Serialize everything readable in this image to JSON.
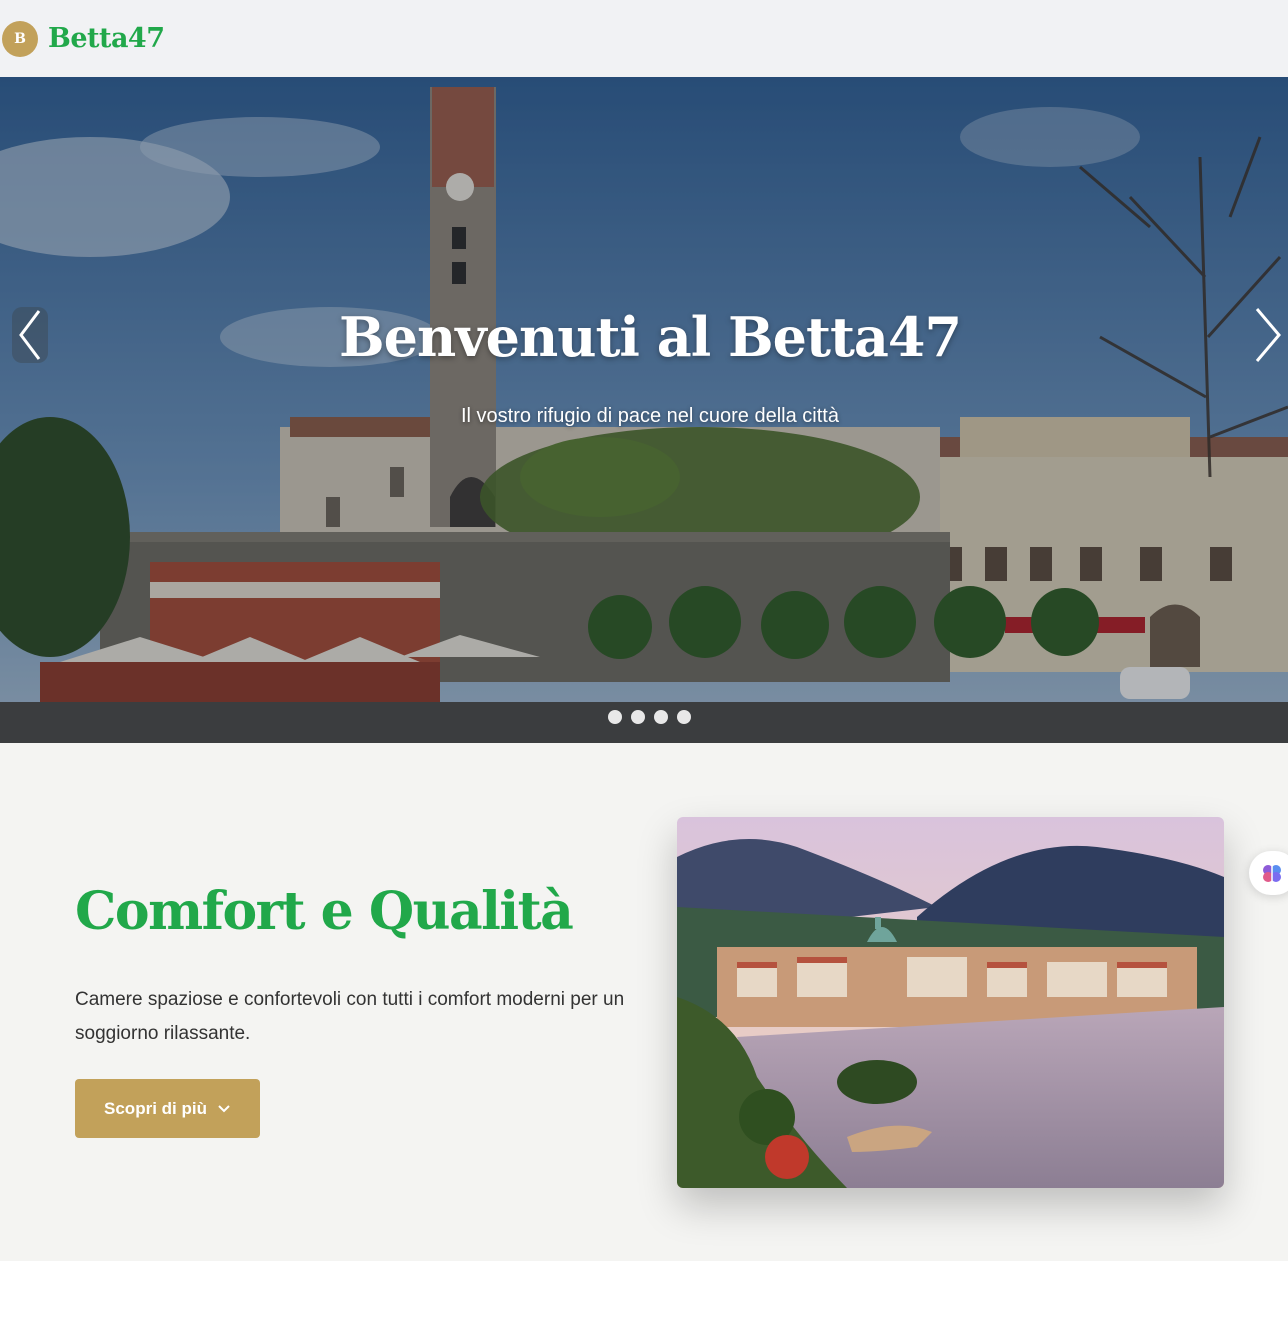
{
  "header": {
    "logo_letter": "B",
    "brand": "Betta47"
  },
  "hero": {
    "title": "Benvenuti al Betta47",
    "subtitle": "Il vostro rifugio di pace nel cuore della città",
    "prev_icon": "chevron-left-icon",
    "next_icon": "chevron-right-icon",
    "slide_count": 4
  },
  "comfort": {
    "title": "Comfort e Qualità",
    "text": "Camere spaziose e confortevoli con tutti i comfort moderni per un soggiorno rilassante.",
    "button_label": "Scopri di più",
    "button_icon": "chevron-down-icon"
  },
  "floating": {
    "icon": "brain-icon"
  },
  "colors": {
    "brand_green": "#21a84a",
    "accent_gold": "#c2a15a",
    "section_bg": "#f4f4f2"
  }
}
